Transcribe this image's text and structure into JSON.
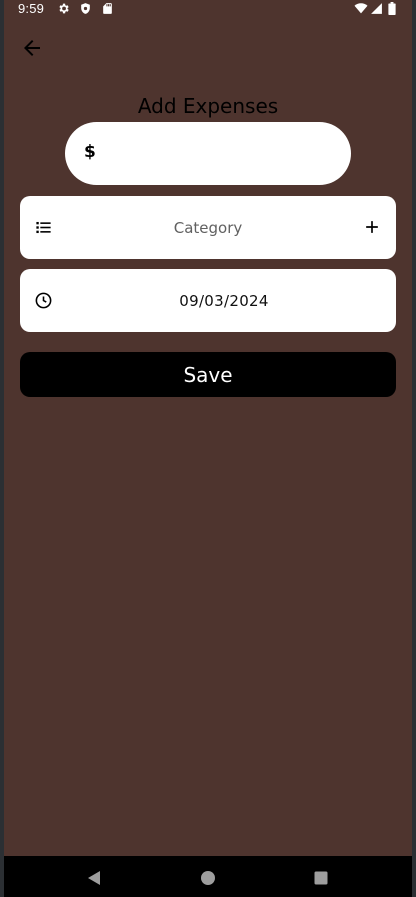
{
  "status_bar": {
    "time": "9:59",
    "icons": [
      "gear-icon",
      "shield-icon",
      "sd-card-icon",
      "wifi-icon",
      "signal-icon",
      "battery-icon"
    ]
  },
  "screen": {
    "title": "Add Expenses",
    "background": "#4e342e"
  },
  "amount": {
    "currency_symbol": "$",
    "value": "",
    "placeholder": ""
  },
  "category": {
    "label": "Category",
    "lead_icon": "list-icon",
    "action_icon": "plus-icon"
  },
  "date": {
    "value": "09/03/2024",
    "lead_icon": "clock-icon"
  },
  "save": {
    "label": "Save"
  },
  "nav": {
    "buttons": [
      "back-triangle-icon",
      "home-circle-icon",
      "recents-square-icon"
    ]
  }
}
